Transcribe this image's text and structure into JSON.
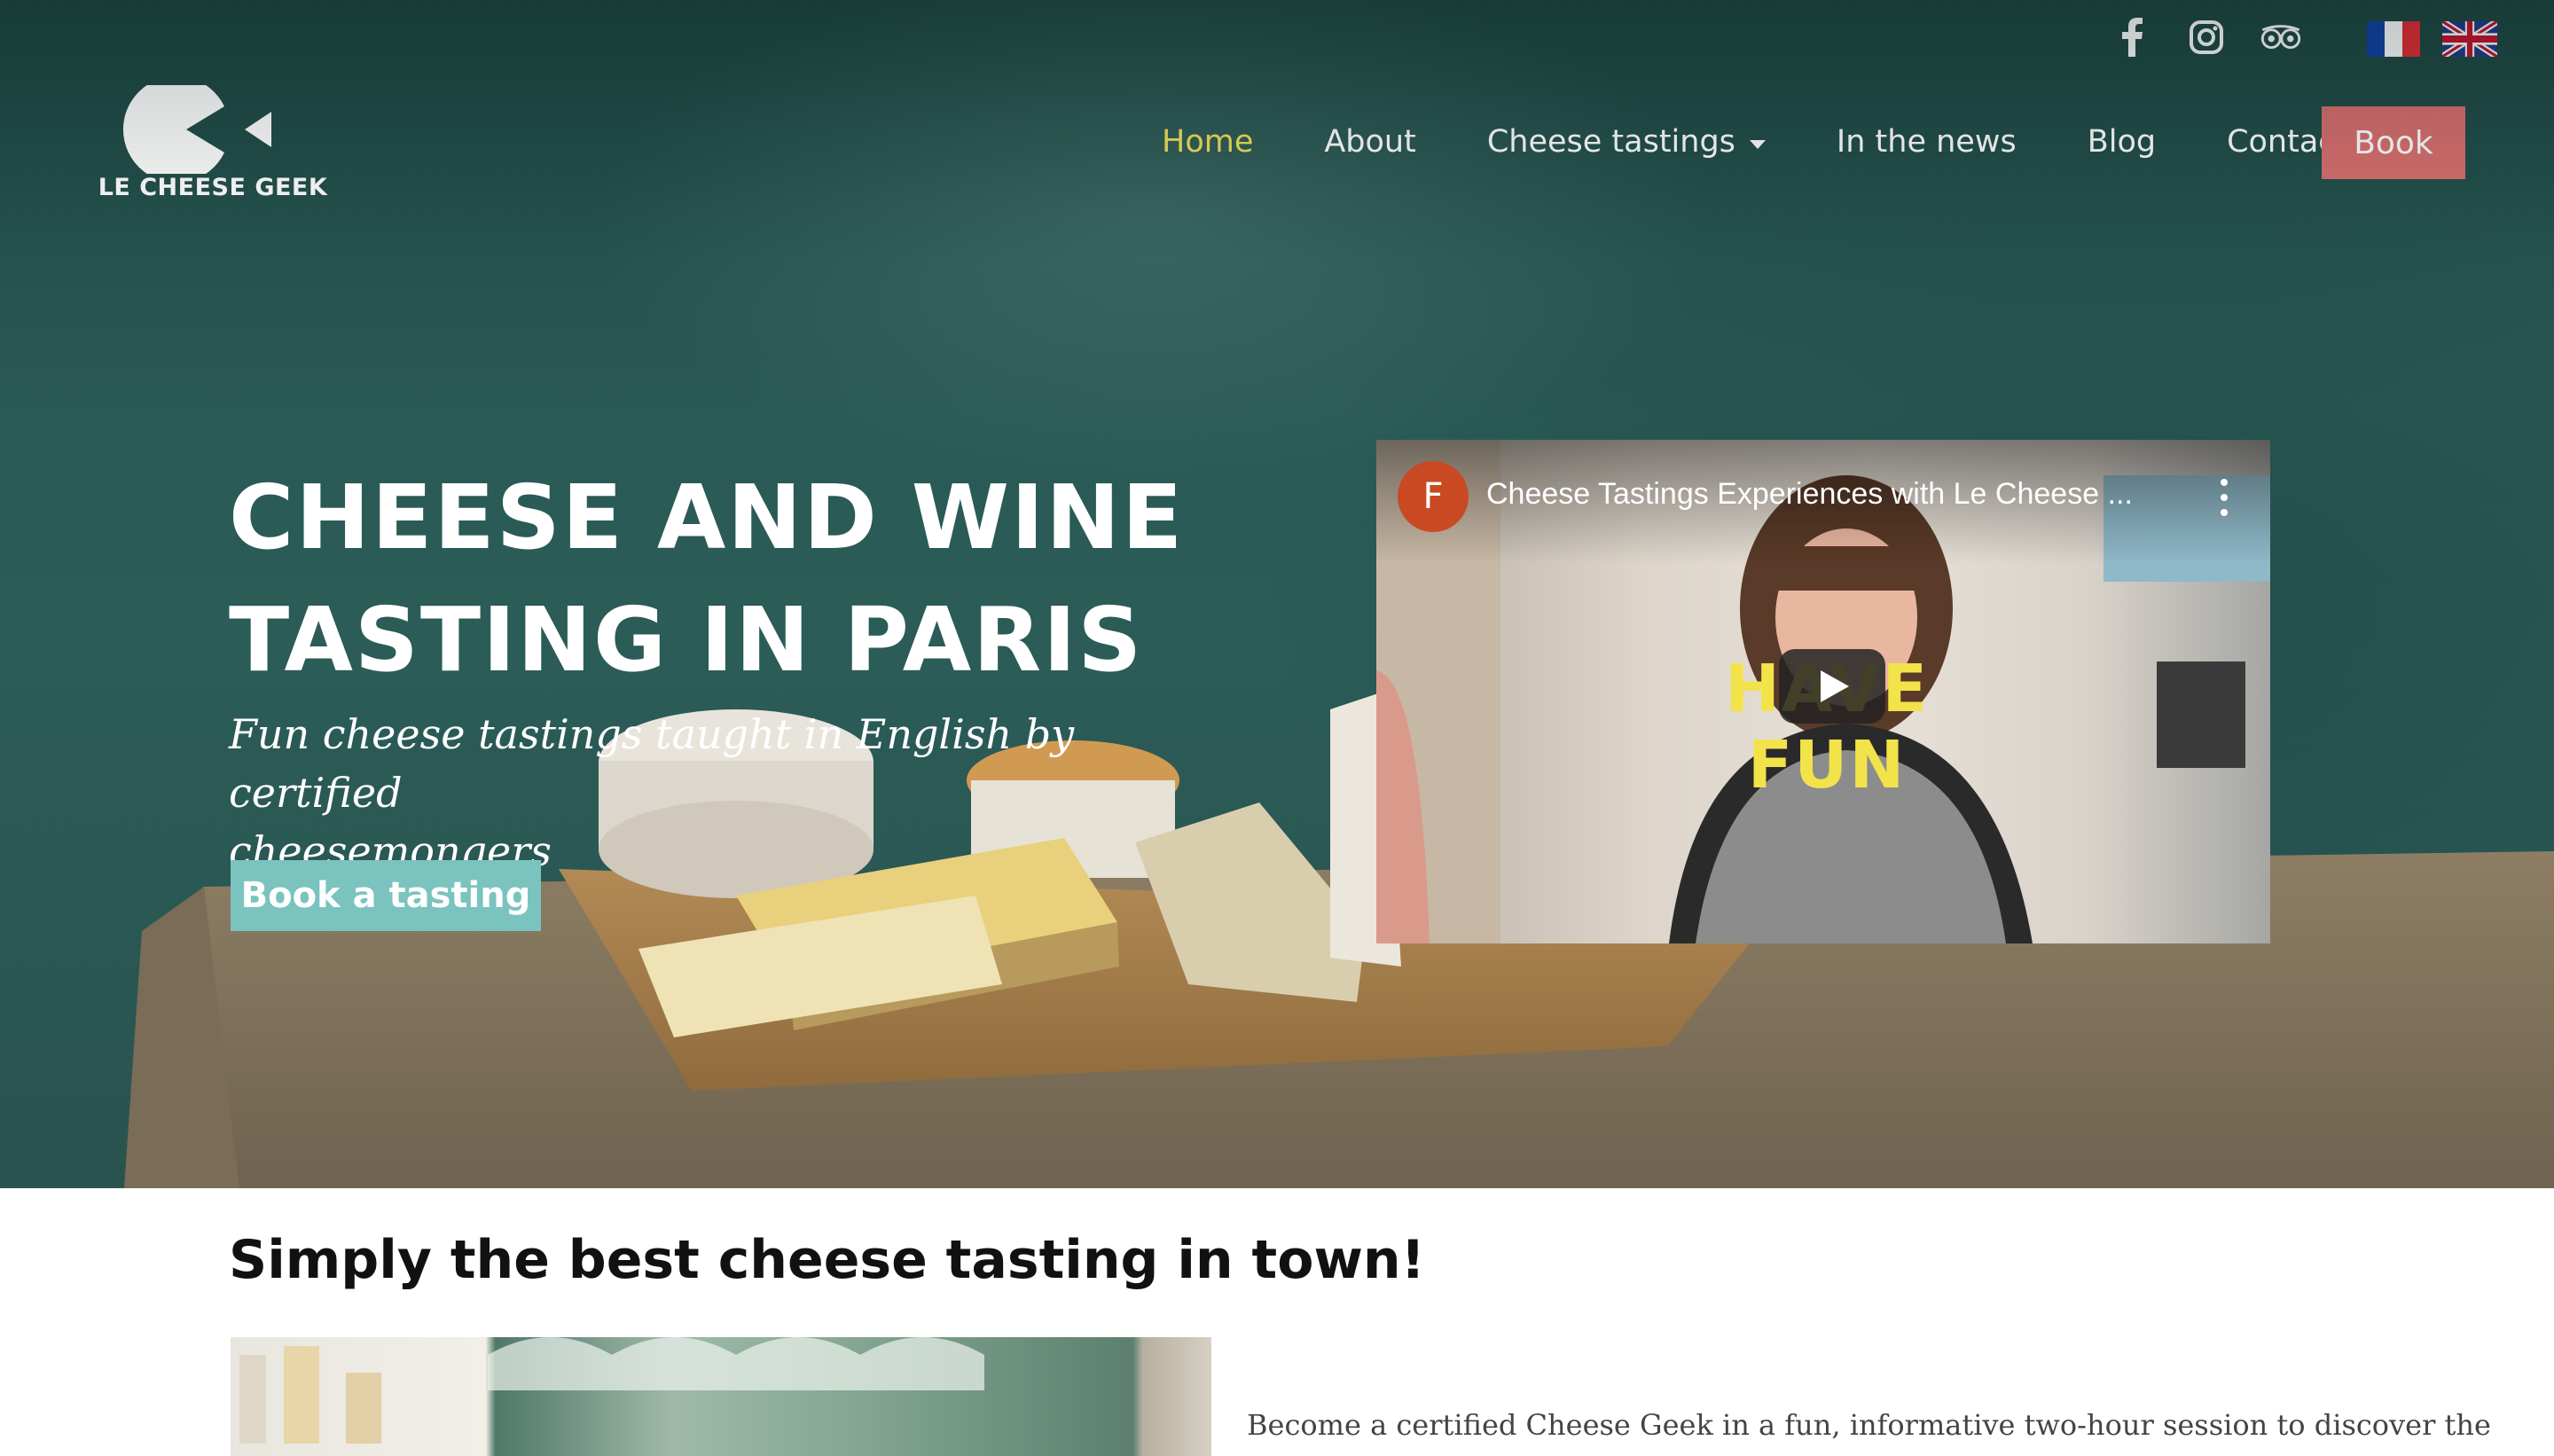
{
  "brand": {
    "name": "LE CHEESE GEEK"
  },
  "social": [
    {
      "name": "facebook",
      "icon": "facebook-icon"
    },
    {
      "name": "instagram",
      "icon": "instagram-icon"
    },
    {
      "name": "tripadvisor",
      "icon": "tripadvisor-icon"
    }
  ],
  "languages": [
    {
      "code": "fr",
      "icon": "french-flag-icon"
    },
    {
      "code": "en",
      "icon": "uk-flag-icon"
    }
  ],
  "nav": {
    "items": [
      {
        "label": "Home",
        "active": true
      },
      {
        "label": "About"
      },
      {
        "label": "Cheese tastings",
        "dropdown": true
      },
      {
        "label": "In the news"
      },
      {
        "label": "Blog"
      },
      {
        "label": "Contact"
      }
    ],
    "book_label": "Book"
  },
  "hero": {
    "headline_line1": "CHEESE AND WINE",
    "headline_line2": "TASTING IN PARIS",
    "subline_line1": "Fun cheese tastings taught in English by certified",
    "subline_line2": "cheesemongers",
    "cta_label": "Book a tasting"
  },
  "video": {
    "channel_initial": "F",
    "title": "Cheese Tastings Experiences with Le Cheese ...",
    "overlay_text": "HAVE FUN"
  },
  "intro": {
    "title": "Simply the best cheese tasting in town!",
    "body": "Become a certified Cheese Geek in a fun, informative two-hour session to discover the"
  },
  "colors": {
    "nav_active": "#f1de5b",
    "book_button": "#d86e6e",
    "cta_button": "#7bc3bf",
    "hero_background": "#2b5c57"
  }
}
